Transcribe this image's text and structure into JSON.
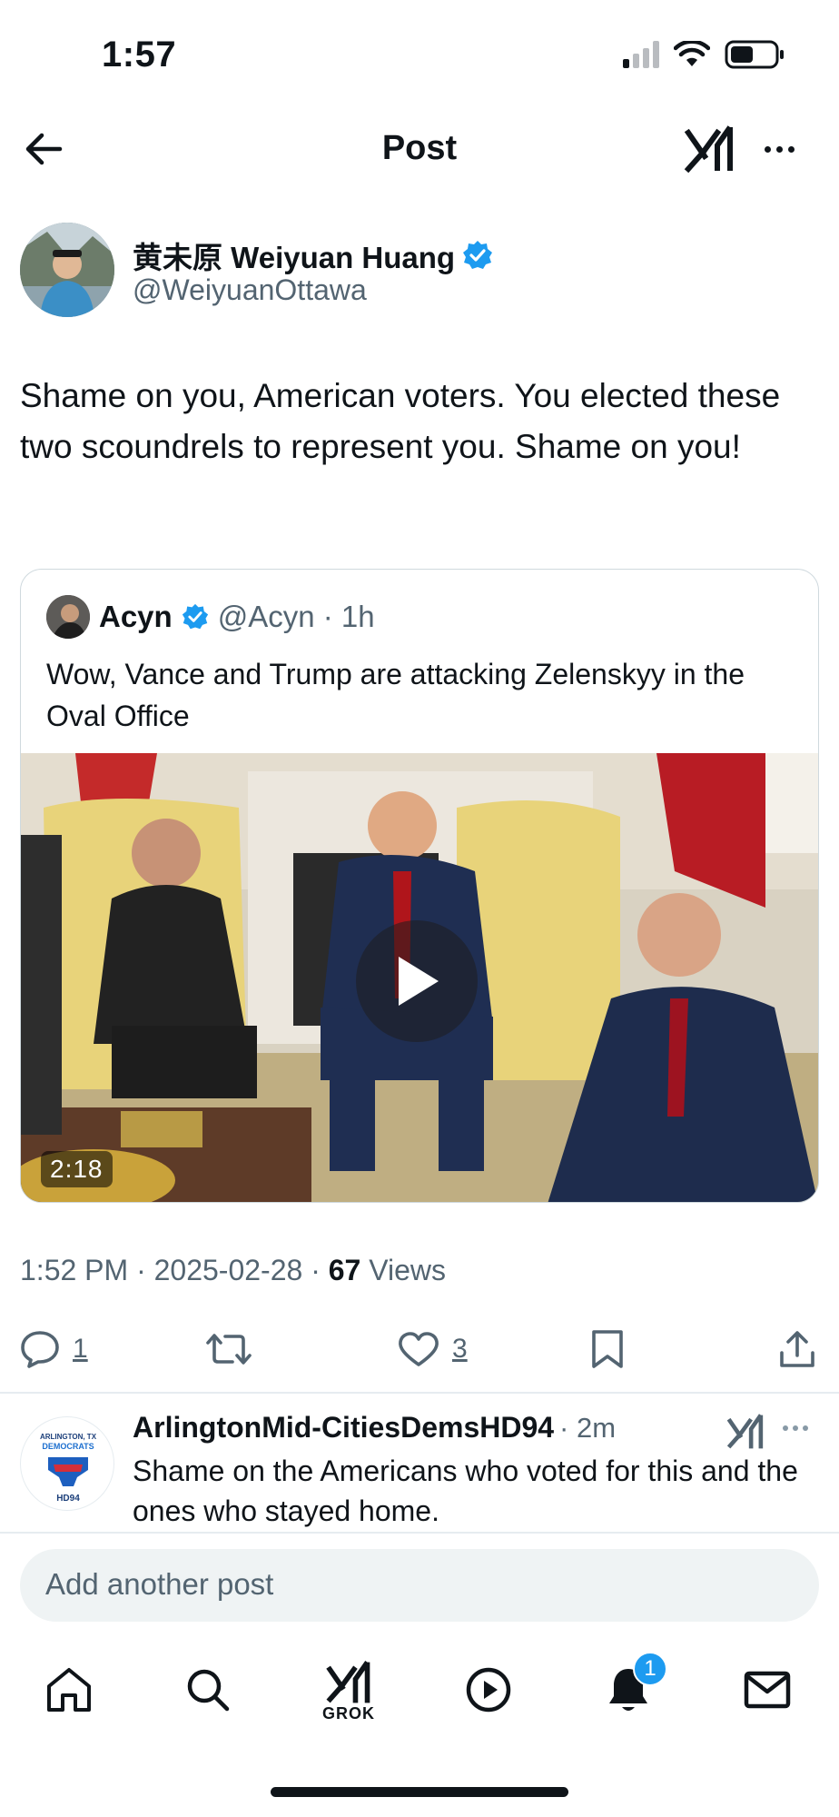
{
  "status_bar": {
    "time": "1:57"
  },
  "header": {
    "title": "Post"
  },
  "post": {
    "author_name": "黄未原 Weiyuan Huang",
    "author_handle": "@WeiyuanOttawa",
    "text": "Shame on you, American voters. You elected these two scoundrels to represent you. Shame on you!",
    "timestamp": "1:52 PM · 2025-02-28 · ",
    "views_count": "67",
    "views_label": " Views",
    "replies": "1",
    "likes": "3"
  },
  "quote": {
    "author_name": "Acyn",
    "author_handle": "@Acyn · 1h",
    "text": "Wow, Vance and Trump are attacking Zelenskyy in the Oval Office",
    "video_duration": "2:18"
  },
  "reply": {
    "author_name": "ArlingtonMid-CitiesDemsHD94",
    "time": "· 2m",
    "text": "Shame on the Americans who voted for this and the ones who stayed home.",
    "avatar_lines": [
      "ARLINGTON, TX",
      "DEMOCRATS",
      "HD94"
    ]
  },
  "composer": {
    "placeholder": "Add another post"
  },
  "tabbar": {
    "grok_label": "GROK",
    "notifications_badge": "1"
  },
  "colors": {
    "accent": "#1d9bf0",
    "text": "#0f1419",
    "secondary": "#536471"
  }
}
